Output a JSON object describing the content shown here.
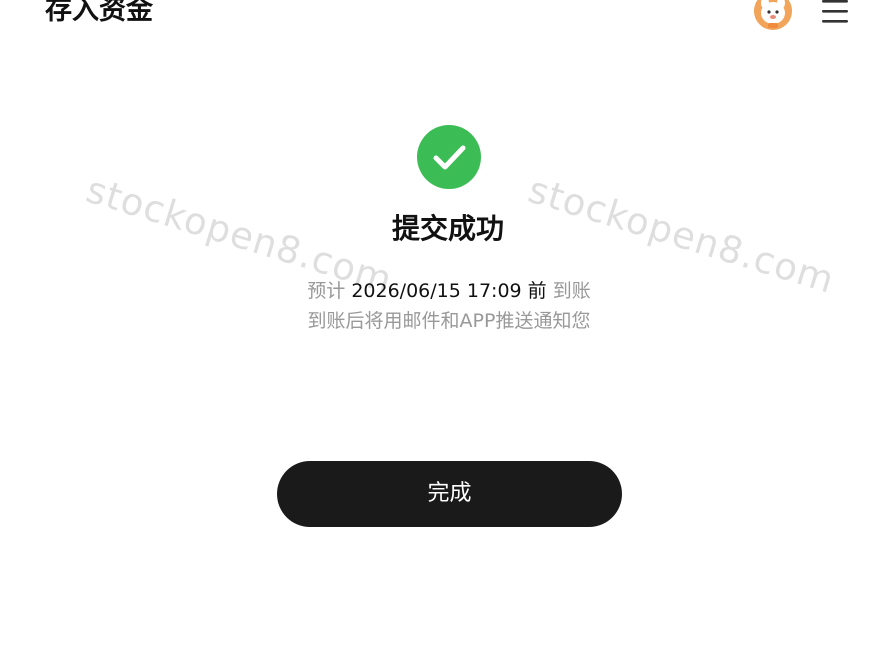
{
  "header": {
    "title": "存入资金",
    "avatar_icon": "cartoon-avatar-icon",
    "menu_icon": "hamburger-menu-icon"
  },
  "watermark": {
    "left_text": "stockopen8.com",
    "right_text": "stockopen8.com"
  },
  "result": {
    "icon": "check-circle-icon",
    "icon_color": "#3cbc55",
    "title": "提交成功",
    "eta_prefix": "预计",
    "eta_datetime": "2026/06/15 17:09",
    "eta_before": "前",
    "eta_suffix": "到账",
    "notify_text": "到账后将用邮件和APP推送通知您"
  },
  "actions": {
    "done_label": "完成",
    "button_color": "#1a1a1a"
  }
}
